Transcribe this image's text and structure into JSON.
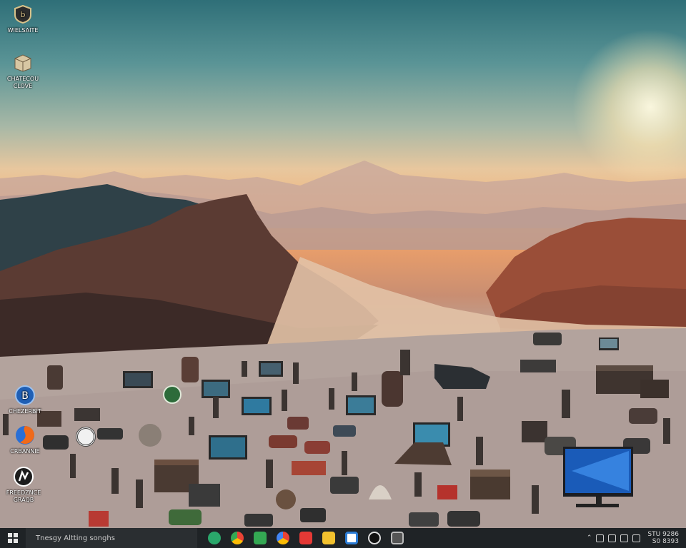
{
  "desktop": {
    "icons": [
      {
        "label": "WIELSAITE",
        "icon": "shield-app-icon",
        "color": "#d8c28a"
      },
      {
        "label": "CHATECOU\nCLOVE",
        "icon": "package-box-icon",
        "color": "#d7c7a3"
      },
      {
        "label": "CHEZERBIT",
        "icon": "blue-circle-b-icon",
        "color": "#1f5fb5"
      },
      {
        "label": "CRBANNIE",
        "icon": "firefox-like-icon",
        "color": "#e66a1f"
      },
      {
        "label": "FREEDZNCE\nGRAQB",
        "icon": "white-n-logo-icon",
        "color": "#1c1c1c"
      }
    ]
  },
  "taskbar": {
    "search_placeholder": "Tnesgy Altting songhs",
    "pinned_apps": [
      {
        "name": "chat-app-icon",
        "color": "#2aa86b"
      },
      {
        "name": "chrome-like-icon",
        "color": "#e4b400"
      },
      {
        "name": "green-tile-icon",
        "color": "#34a853"
      },
      {
        "name": "browser-icon",
        "color": "#ea4335"
      },
      {
        "name": "red-square-icon",
        "color": "#e53935"
      },
      {
        "name": "file-explorer-icon",
        "color": "#f2c12e"
      },
      {
        "name": "store-icon",
        "color": "#2b7bd3"
      },
      {
        "name": "camera-icon",
        "color": "#111111"
      },
      {
        "name": "settings-icon",
        "color": "#555555"
      }
    ],
    "clock_time": "STU 9286",
    "clock_date": "S0 8393"
  }
}
